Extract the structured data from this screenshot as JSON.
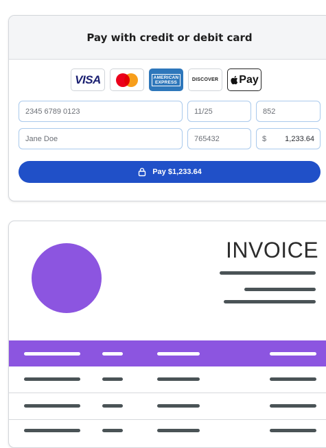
{
  "payment": {
    "title": "Pay with credit or debit card",
    "card_brands": {
      "visa": "VISA",
      "mastercard_icon": "mastercard-logo",
      "amex_line1": "AMERICAN",
      "amex_line2": "EXPRESS",
      "discover_pre": "DISC",
      "discover_o": "O",
      "discover_post": "VER",
      "applepay": "Pay"
    },
    "fields": {
      "card_number": "2345 6789 0123",
      "expiry": "11/25",
      "cvc": "852",
      "name": "Jane Doe",
      "postal": "765432",
      "currency": "$",
      "amount": "1,233.64"
    },
    "pay_button_label": "Pay $1,233.64",
    "colors": {
      "accent": "#2050c8",
      "field_border": "#a9c9ec"
    }
  },
  "invoice": {
    "title": "INVOICE",
    "colors": {
      "accent": "#8c55e0",
      "line": "#4a5356"
    }
  }
}
